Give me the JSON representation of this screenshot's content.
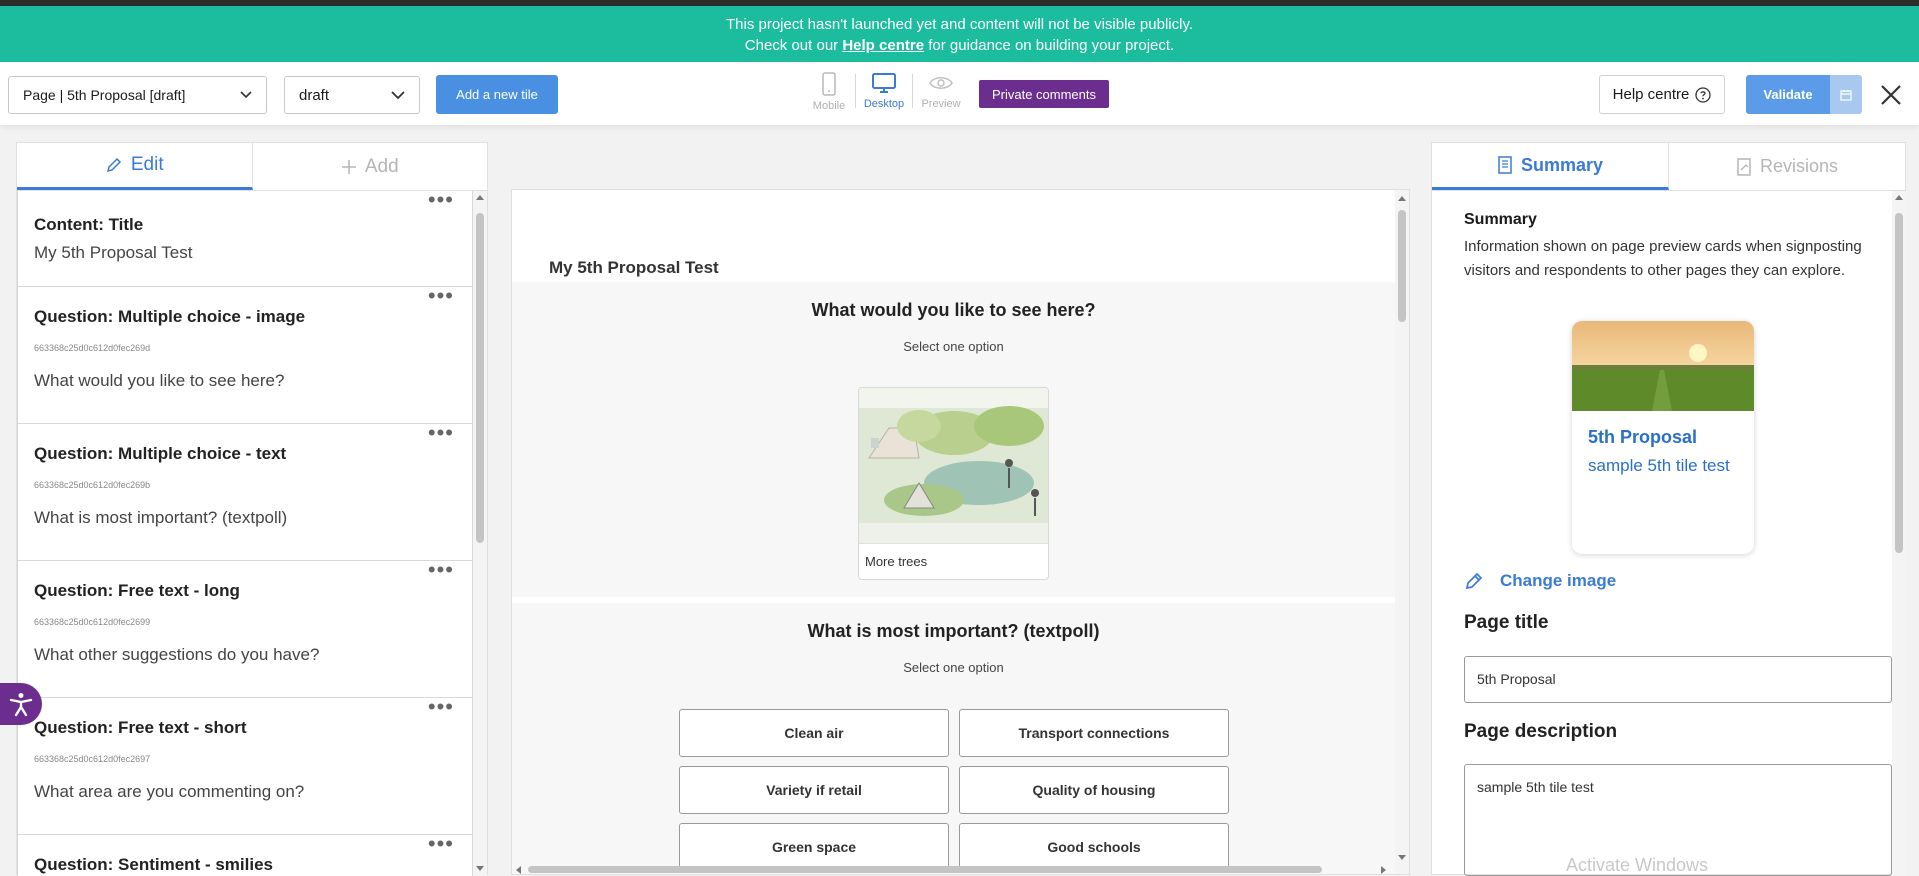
{
  "banner": {
    "line1": "This project hasn't launched yet and content will not be visible publicly.",
    "line2_prefix": "Check out our",
    "line2_link": "Help centre",
    "line2_suffix": "for guidance on building your project."
  },
  "toolbar": {
    "page_select": "Page | 5th Proposal [draft]",
    "status_select": "draft",
    "add_tile": "Add a new tile",
    "devices": [
      {
        "label": "Mobile",
        "icon": "mobile-icon"
      },
      {
        "label": "Desktop",
        "icon": "desktop-icon"
      },
      {
        "label": "Preview",
        "icon": "eye-icon"
      }
    ],
    "private_comments": "Private comments",
    "help_centre": "Help centre",
    "validate": "Validate"
  },
  "left": {
    "tabs": {
      "edit": "Edit",
      "add": "Add"
    },
    "tiles": [
      {
        "kind": "Content: Title",
        "id": "",
        "text": "My 5th Proposal Test"
      },
      {
        "kind": "Question: Multiple choice - image",
        "id": "663368c25d0c612d0fec269d",
        "text": "What would you like to see here?"
      },
      {
        "kind": "Question: Multiple choice - text",
        "id": "663368c25d0c612d0fec269b",
        "text": "What is most important? (textpoll)"
      },
      {
        "kind": "Question: Free text - long",
        "id": "663368c25d0c612d0fec2699",
        "text": "What other suggestions do you have?"
      },
      {
        "kind": "Question: Free text - short",
        "id": "663368c25d0c612d0fec2697",
        "text": "What area are you commenting on?"
      },
      {
        "kind": "Question: Sentiment - smilies",
        "id": "",
        "text": ""
      }
    ]
  },
  "center": {
    "page_title": "My 5th Proposal Test",
    "q1": {
      "title": "What would you like to see here?",
      "sub": "Select one option",
      "option": "More trees"
    },
    "q2": {
      "title": "What is most important? (textpoll)",
      "sub": "Select one option",
      "options": [
        "Clean air",
        "Transport connections",
        "Variety if retail",
        "Quality of housing",
        "Green space",
        "Good schools"
      ]
    }
  },
  "right": {
    "tabs": {
      "summary": "Summary",
      "revisions": "Revisions"
    },
    "summary_heading": "Summary",
    "summary_text": "Information shown on page preview cards when signposting visitors and respondents to other pages they can explore.",
    "card_title": "5th Proposal",
    "card_desc": "sample 5th tile test",
    "change_image": "Change image",
    "page_title_label": "Page title",
    "page_title_value": "5th Proposal",
    "page_desc_label": "Page description",
    "page_desc_value": "sample 5th tile test"
  },
  "watermark": "Activate Windows",
  "colors": {
    "banner": "#1bbd9e",
    "accent": "#3a7bd5",
    "purple": "#6b2d8e"
  }
}
